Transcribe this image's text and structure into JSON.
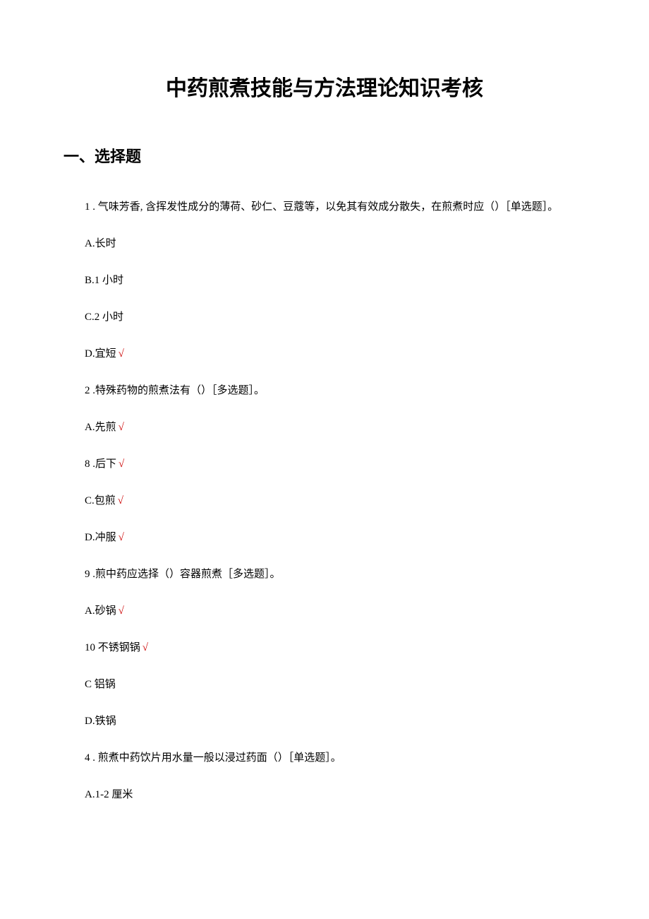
{
  "title": "中药煎煮技能与方法理论知识考核",
  "section_header": "一、选择题",
  "items": {
    "q1": "1 . 气味芳香, 含挥发性成分的薄荷、砂仁、豆蔻等，以免其有效成分散失，在煎煮时应（）［单选题］。",
    "o1a": "A.长时",
    "o1b": "B.1 小时",
    "o1c": "C.2 小时",
    "o1d": "D.宜短",
    "q2": "2  .特殊药物的煎煮法有（）［多选题］。",
    "o2a": "A.先煎",
    "o2b": "8  .后下",
    "o2c": "C.包煎",
    "o2d": "D.冲服",
    "q3": "9  .煎中药应选择（）容器煎煮［多选题］。",
    "o3a": "A.砂锅",
    "o3b": "10  不锈钢锅",
    "o3c": "C 铝锅",
    "o3d": "D.铁锅",
    "q4": "4  . 煎煮中药饮片用水量一般以浸过药面（）［单选题］。",
    "o4a": "A.1-2 厘米"
  },
  "check": "√"
}
